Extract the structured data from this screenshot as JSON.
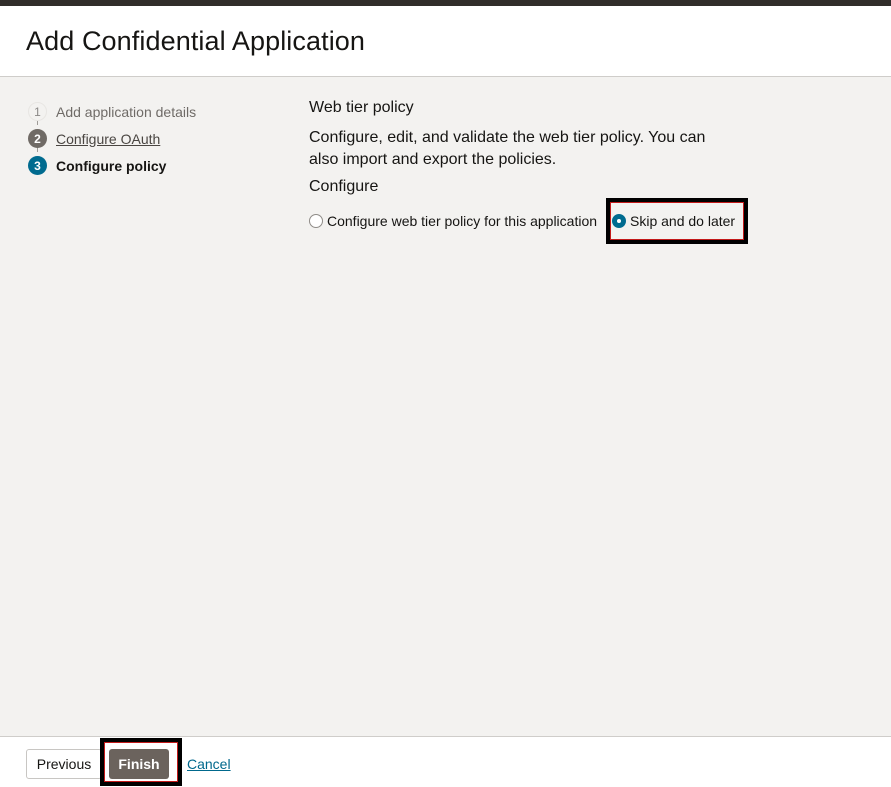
{
  "header": {
    "title": "Add Confidential Application"
  },
  "steps": [
    {
      "number": "1",
      "label": "Add application details",
      "state": "pending"
    },
    {
      "number": "2",
      "label": "Configure OAuth",
      "state": "done"
    },
    {
      "number": "3",
      "label": "Configure policy",
      "state": "current"
    }
  ],
  "content": {
    "section_title": "Web tier policy",
    "description": "Configure, edit, and validate the web tier policy. You can also import and export the policies.",
    "group_title": "Configure",
    "options": [
      {
        "label": "Configure web tier policy for this application",
        "checked": false
      },
      {
        "label": "Skip and do later",
        "checked": true
      }
    ]
  },
  "footer": {
    "previous_label": "Previous",
    "finish_label": "Finish",
    "cancel_label": "Cancel"
  },
  "colors": {
    "accent": "#006b8f",
    "finish_button": "#6b635d",
    "topbar": "#312d2a",
    "highlight": "#000000"
  }
}
